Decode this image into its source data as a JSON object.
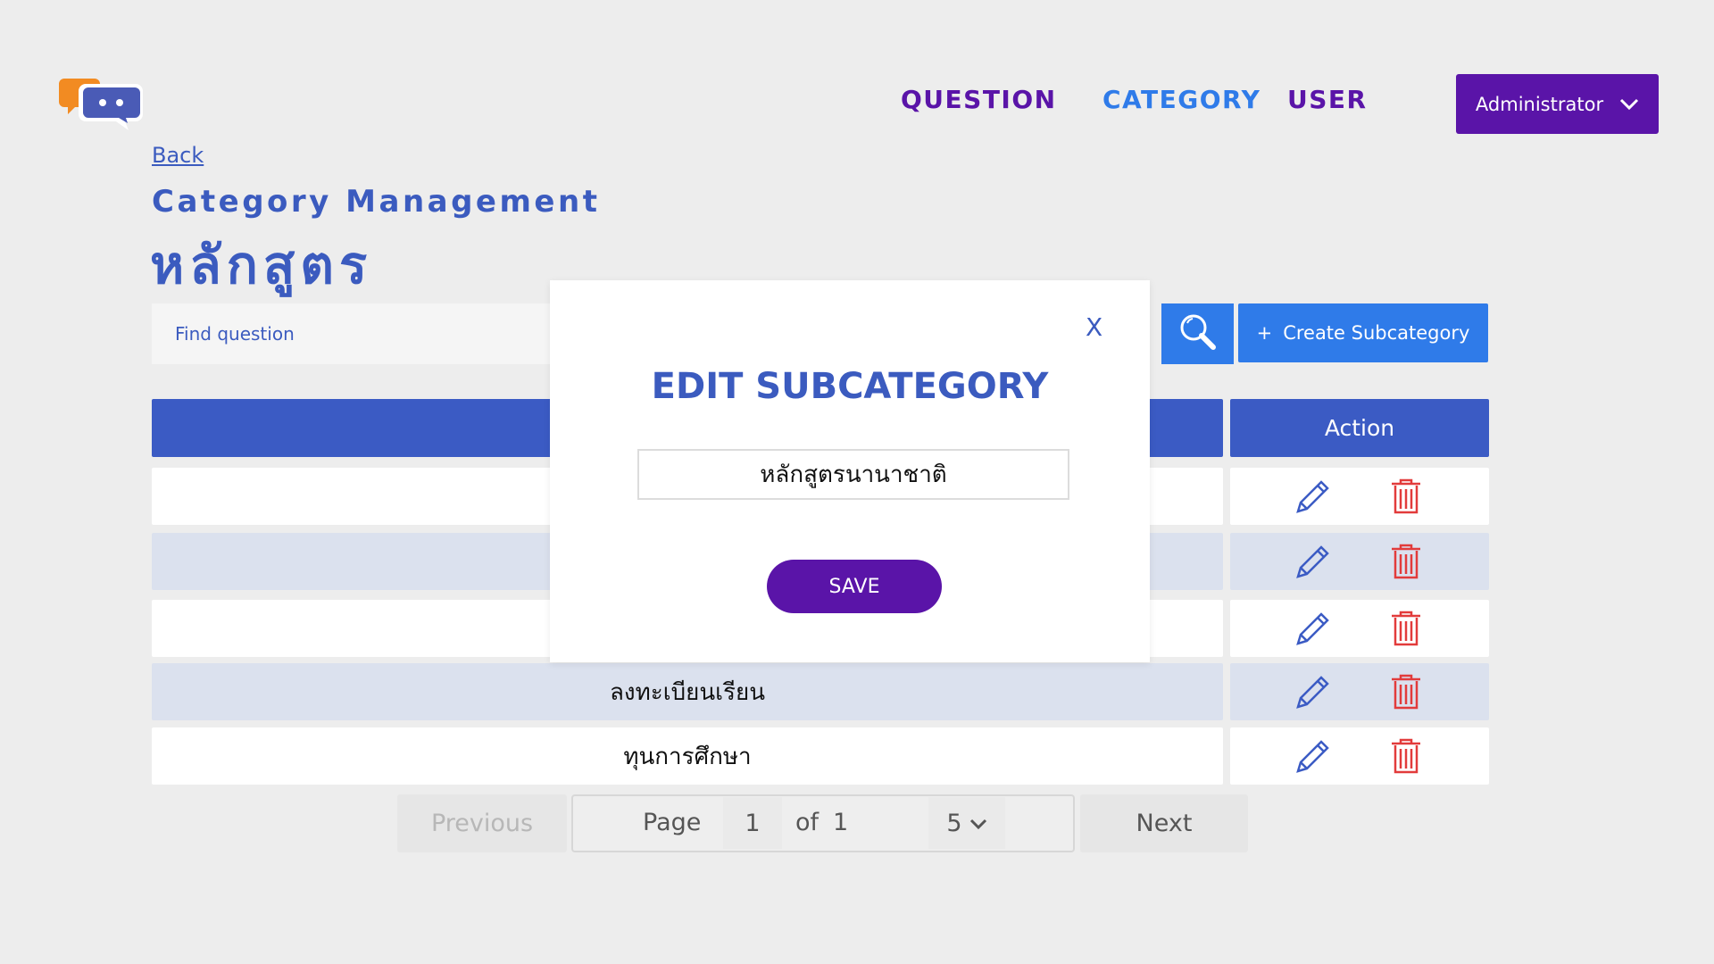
{
  "nav": {
    "items": [
      {
        "label": "QUESTION"
      },
      {
        "label": "CATEGORY"
      },
      {
        "label": "USER"
      }
    ],
    "account_label": "Administrator"
  },
  "page": {
    "back_label": "Back",
    "subtitle": "Category Management",
    "title": "หลักสูตร"
  },
  "search": {
    "placeholder": "Find question"
  },
  "toolbar": {
    "create_label": "Create Subcategory",
    "create_icon": "+"
  },
  "table": {
    "header_action": "Action",
    "rows": [
      {
        "name": ""
      },
      {
        "name": ""
      },
      {
        "name": ""
      },
      {
        "name": "ลงทะเบียนเรียน"
      },
      {
        "name": "ทุนการศึกษา"
      }
    ]
  },
  "pagination": {
    "previous_label": "Previous",
    "page_label": "Page",
    "current_page": "1",
    "of_label": "of",
    "total_pages": "1",
    "page_size": "5",
    "next_label": "Next"
  },
  "modal": {
    "close_label": "X",
    "title": "EDIT SUBCATEGORY",
    "input_value": "หลักสูตรนานาชาติ",
    "save_label": "SAVE"
  },
  "colors": {
    "primary_blue": "#3b5bc4",
    "accent_blue": "#2f7be9",
    "purple": "#5a14a8",
    "delete_red": "#e23b3b"
  }
}
